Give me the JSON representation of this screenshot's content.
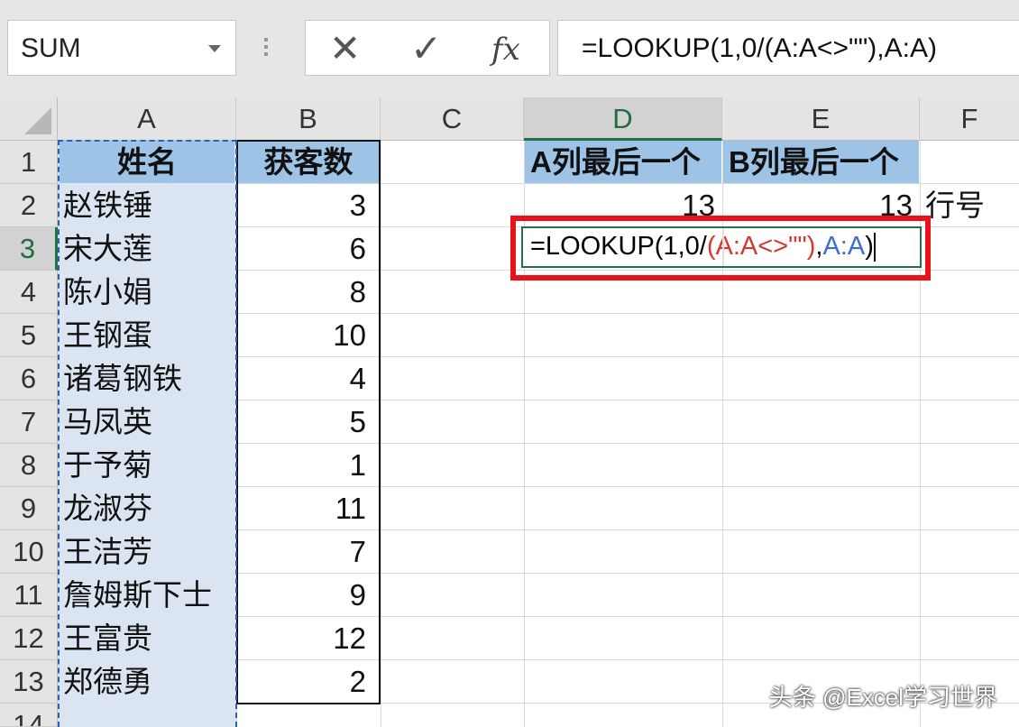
{
  "name_box": {
    "value": "SUM"
  },
  "formula_buttons": {
    "cancel": "✕",
    "enter": "✓",
    "fx": "fx"
  },
  "formula_bar": {
    "value": "=LOOKUP(1,0/(A:A<>\"\"),A:A)"
  },
  "columns": [
    "A",
    "B",
    "C",
    "D",
    "E",
    "F"
  ],
  "rows": [
    "1",
    "2",
    "3",
    "4",
    "5",
    "6",
    "7",
    "8",
    "9",
    "10",
    "11",
    "12",
    "13",
    "14"
  ],
  "headers": {
    "a1": "姓名",
    "b1": "获客数",
    "d1": "A列最后一个",
    "e1": "B列最后一个"
  },
  "data_rows": [
    {
      "name": "赵铁锤",
      "count": "3"
    },
    {
      "name": "宋大莲",
      "count": "6"
    },
    {
      "name": "陈小娟",
      "count": "8"
    },
    {
      "name": "王钢蛋",
      "count": "10"
    },
    {
      "name": "诸葛钢铁",
      "count": "4"
    },
    {
      "name": "马凤英",
      "count": "5"
    },
    {
      "name": "于予菊",
      "count": "1"
    },
    {
      "name": "龙淑芬",
      "count": "11"
    },
    {
      "name": "王洁芳",
      "count": "7"
    },
    {
      "name": "詹姆斯下士",
      "count": "9"
    },
    {
      "name": "王富贵",
      "count": "12"
    },
    {
      "name": "郑德勇",
      "count": "2"
    }
  ],
  "results": {
    "d2": "13",
    "e2": "13",
    "f2": "行号"
  },
  "editing_cell": {
    "part1": "=LOOKUP(1,0/",
    "part2": "(A:A<>\"\")",
    "part3": ",",
    "part4": "A:A",
    "part5": ")"
  },
  "colors": {
    "ref_red": "#d03a2f",
    "ref_blue": "#3b6fc9",
    "header_fill": "#9dc3e6",
    "highlight_box": "#e8121a"
  },
  "watermark": "头条 @Excel学习世界"
}
